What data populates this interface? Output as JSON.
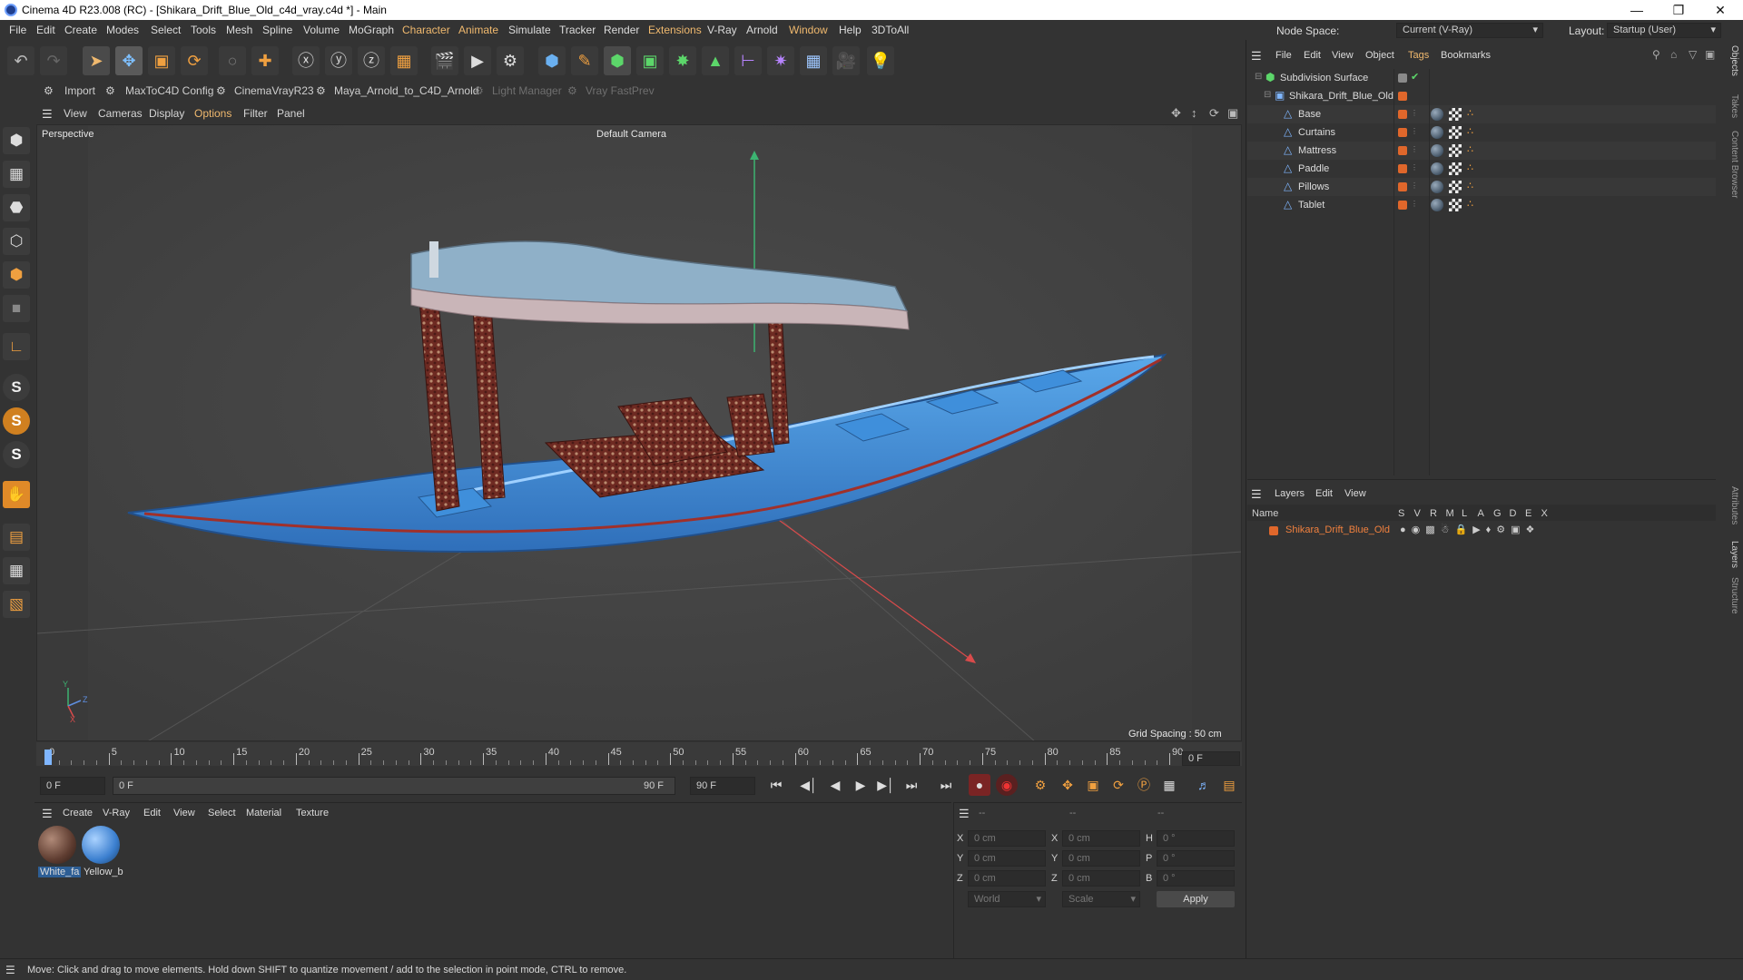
{
  "window": {
    "title": "Cinema 4D R23.008 (RC) - [Shikara_Drift_Blue_Old_c4d_vray.c4d *] - Main",
    "node_space_label": "Node Space:",
    "node_space_value": "Current (V-Ray)",
    "layout_label": "Layout:",
    "layout_value": "Startup (User)"
  },
  "menubar": [
    "File",
    "Edit",
    "Create",
    "Modes",
    "Select",
    "Tools",
    "Mesh",
    "Spline",
    "Volume",
    "MoGraph",
    "Character",
    "Animate",
    "Simulate",
    "Tracker",
    "Render",
    "Extensions",
    "V-Ray",
    "Arnold",
    "Window",
    "Help",
    "3DToAll"
  ],
  "plugins": {
    "import": "Import",
    "maxtoc4d": "MaxToC4D Config",
    "cinemavray": "CinemaVrayR23",
    "maya_arnold": "Maya_Arnold_to_C4D_Arnold",
    "light_manager": "Light Manager",
    "vray_fastprev": "Vray FastPrev"
  },
  "viewport_menu": [
    "View",
    "Cameras",
    "Display",
    "Options",
    "Filter",
    "Panel"
  ],
  "viewport": {
    "view_name": "Perspective",
    "camera": "Default Camera",
    "grid_spacing": "Grid Spacing : 50 cm",
    "axis_x": "X",
    "axis_y": "Y",
    "axis_z": "Z"
  },
  "timeline": {
    "ticks": [
      "0",
      "5",
      "10",
      "15",
      "20",
      "25",
      "30",
      "35",
      "40",
      "45",
      "50",
      "55",
      "60",
      "65",
      "70",
      "75",
      "80",
      "85",
      "90"
    ],
    "current_frame": "0 F",
    "start_field": "0 F",
    "range_start": "0 F",
    "range_end": "90 F",
    "end_field": "90 F",
    "max_frame": 90
  },
  "material_menu": [
    "Create",
    "V-Ray",
    "Edit",
    "View",
    "Select",
    "Material",
    "Texture"
  ],
  "materials": [
    {
      "name": "White_fa",
      "selected": true
    },
    {
      "name": "Yellow_b",
      "selected": false
    }
  ],
  "coords": {
    "header_a": "--",
    "header_b": "--",
    "header_c": "--",
    "rows": [
      {
        "l1": "X",
        "v1": "0 cm",
        "l2": "X",
        "v2": "0 cm",
        "l3": "H",
        "v3": "0 °"
      },
      {
        "l1": "Y",
        "v1": "0 cm",
        "l2": "Y",
        "v2": "0 cm",
        "l3": "P",
        "v3": "0 °"
      },
      {
        "l1": "Z",
        "v1": "0 cm",
        "l2": "Z",
        "v2": "0 cm",
        "l3": "B",
        "v3": "0 °"
      }
    ],
    "world": "World",
    "scale": "Scale",
    "apply": "Apply"
  },
  "object_manager": {
    "menu": [
      "File",
      "Edit",
      "View",
      "Object",
      "Tags",
      "Bookmarks"
    ],
    "objects": [
      {
        "name": "Subdivision Surface",
        "indent": 0
      },
      {
        "name": "Shikara_Drift_Blue_Old",
        "indent": 1
      },
      {
        "name": "Base",
        "indent": 2
      },
      {
        "name": "Curtains",
        "indent": 2
      },
      {
        "name": "Mattress",
        "indent": 2
      },
      {
        "name": "Paddle",
        "indent": 2
      },
      {
        "name": "Pillows",
        "indent": 2
      },
      {
        "name": "Tablet",
        "indent": 2
      }
    ]
  },
  "layers": {
    "menu": [
      "Layers",
      "Edit",
      "View"
    ],
    "columns": [
      "Name",
      "S",
      "V",
      "R",
      "M",
      "L",
      "A",
      "G",
      "D",
      "E",
      "X"
    ],
    "items": [
      {
        "name": "Shikara_Drift_Blue_Old",
        "color": "#e0672b"
      }
    ]
  },
  "side_tabs_top": [
    "Objects",
    "Takes",
    "Content Browser"
  ],
  "side_tabs_bottom": [
    "Attributes",
    "Layers",
    "Structure"
  ],
  "status": "Move: Click and drag to move elements. Hold down SHIFT to quantize movement / add to the selection in point mode, CTRL to remove.",
  "colors": {
    "accent": "#f0b96e",
    "orange_tag": "#e0672b",
    "boat_blue": "#3a86d4",
    "axis_green": "#3cb371",
    "axis_red": "#d94b4b"
  }
}
